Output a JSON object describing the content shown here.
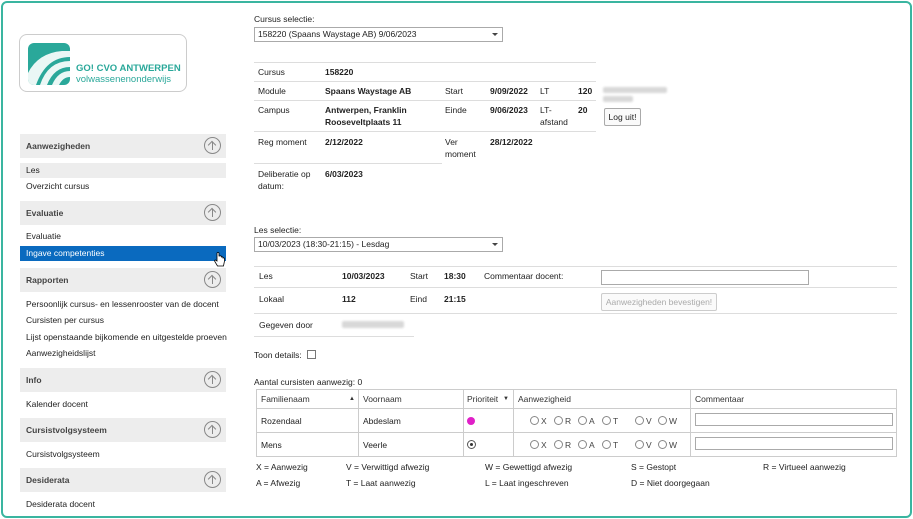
{
  "brand": {
    "title": "GO! CVO ANTWERPEN",
    "subtitle": "volwassenenonderwijs",
    "color": "#2aa89a"
  },
  "sidebar": {
    "sections": [
      {
        "label": "Aanwezigheden",
        "items": [
          "Les",
          "Overzicht cursus"
        ]
      },
      {
        "label": "Evaluatie",
        "items": [
          "Evaluatie",
          "Ingave competenties"
        ]
      },
      {
        "label": "Rapporten",
        "items": [
          "Persoonlijk cursus- en lessenrooster van de docent",
          "Cursisten per cursus",
          "Lijst openstaande bijkomende en uitgestelde proeven",
          "Aanwezigheidslijst"
        ]
      },
      {
        "label": "Info",
        "items": [
          "Kalender docent"
        ]
      },
      {
        "label": "Cursistvolgsysteem",
        "items": [
          "Cursistvolgsysteem"
        ]
      },
      {
        "label": "Desiderata",
        "items": [
          "Desiderata docent"
        ]
      }
    ],
    "active_item": "Ingave competenties",
    "highlight_color": "#0a6abf"
  },
  "course_select": {
    "label": "Cursus selectie:",
    "value": "158220 (Spaans Waystage AB) 9/06/2023"
  },
  "course_info": {
    "cursus_label": "Cursus",
    "cursus_value": "158220",
    "module_label": "Module",
    "module_value": "Spaans Waystage AB",
    "start_label": "Start",
    "start_value": "9/09/2022",
    "lt_label": "LT",
    "lt_value": "120",
    "campus_label": "Campus",
    "campus_line1": "Antwerpen, Franklin",
    "campus_line2": "Rooseveltplaats 11",
    "einde_label": "Einde",
    "einde_value": "9/06/2023",
    "ltafstand_label1": "LT-",
    "ltafstand_label2": "afstand",
    "ltafstand_value": "20",
    "reg_label": "Reg moment",
    "reg_value": "2/12/2022",
    "ver_label1": "Ver",
    "ver_label2": "moment",
    "ver_value": "28/12/2022",
    "delib_label1": "Deliberatie op",
    "delib_label2": "datum:",
    "delib_value": "6/03/2023"
  },
  "logout_button": "Log uit!",
  "lesson_select": {
    "label": "Les selectie:",
    "value": "10/03/2023 (18:30-21:15) - Lesdag"
  },
  "lesson_info": {
    "les_label": "Les",
    "les_value": "10/03/2023",
    "start_label": "Start",
    "start_value": "18:30",
    "comment_label": "Commentaar docent:",
    "lokaal_label": "Lokaal",
    "lokaal_value": "112",
    "eind_label": "Eind",
    "eind_value": "21:15",
    "gegeven_label": "Gegeven door"
  },
  "confirm_button": "Aanwezigheden bevestigen!",
  "toon_details": "Toon details:",
  "count_text": "Aantal cursisten aanwezig: 0",
  "table": {
    "headers": [
      "Familienaam",
      "Voornaam",
      "Prioriteit",
      "Aanwezigheid",
      "Commentaar"
    ],
    "attendance_options": [
      "X",
      "R",
      "A",
      "T",
      "V",
      "W"
    ],
    "rows": [
      {
        "familienaam": "Rozendaal",
        "voornaam": "Abdeslam",
        "priority_icon": "magenta-dot-icon"
      },
      {
        "familienaam": "Mens",
        "voornaam": "Veerle",
        "priority_icon": "target-icon"
      }
    ]
  },
  "legend": [
    [
      "X = Aanwezig",
      "V = Verwittigd afwezig",
      "W = Gewettigd afwezig",
      "S = Gestopt",
      "R = Virtueel aanwezig"
    ],
    [
      "A = Afwezig",
      "T = Laat aanwezig",
      "L = Laat ingeschreven",
      "D = Niet doorgegaan"
    ]
  ]
}
